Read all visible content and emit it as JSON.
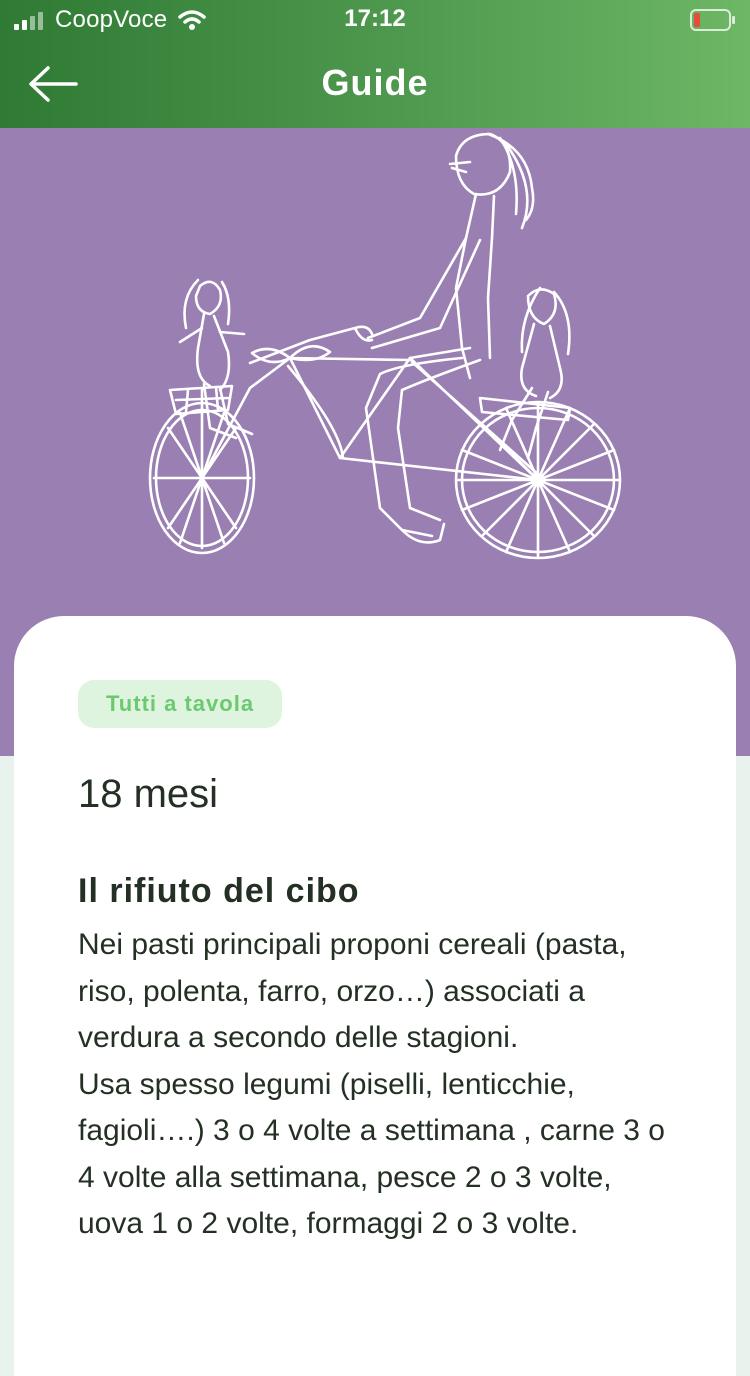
{
  "status_bar": {
    "carrier": "CoopVoce",
    "time": "17:12",
    "signal_icon": "signal-bars-icon",
    "wifi_icon": "wifi-icon",
    "battery_icon": "battery-low-icon",
    "battery_level": 0.1
  },
  "header": {
    "title": "Guide",
    "back_icon": "back-arrow-icon",
    "gradient_start": "#2f7a34",
    "gradient_end": "#6db766"
  },
  "hero": {
    "background": "#9a7fb3",
    "illustration": "bicycle-family-drawing"
  },
  "article": {
    "tag": "Tutti a tavola",
    "age": "18 mesi",
    "title": "Il rifiuto del cibo",
    "paragraphs": [
      "Nei pasti principali proponi cereali (pasta, riso, polenta, farro, orzo…) associati a verdura a secondo delle stagioni.",
      "Usa spesso legumi (piselli, lenticchie, fagioli….) 3 o 4 volte a settimana , carne 3 o 4 volte alla settimana, pesce 2 o 3 volte, uova 1 o 2 volte, formaggi 2 o 3 volte."
    ]
  },
  "colors": {
    "tag_bg": "#def4de",
    "tag_text": "#6cc970",
    "text": "#243024",
    "page_bg": "#e8f3ee"
  }
}
